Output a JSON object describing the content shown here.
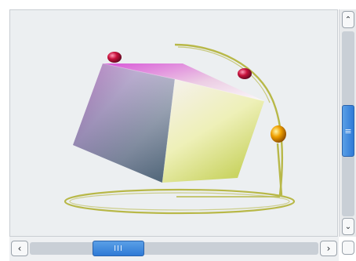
{
  "scroll_pane": {
    "vertical_scrollbar": {
      "up_arrow": "⌃",
      "down_arrow": "⌄",
      "thumb_grip": "≡",
      "thumb_position": 0.45
    },
    "horizontal_scrollbar": {
      "left_arrow": "‹",
      "right_arrow": "›",
      "thumb_grip": "III",
      "thumb_position": 0.29
    }
  },
  "scene": {
    "objects": [
      "rgb-color-cube",
      "orbit-ring",
      "orbit-arc",
      "orbit-rod",
      "sphere",
      "sphere",
      "sphere"
    ],
    "colors": {
      "ring": "#b8b848",
      "magenta_corner": "#e05ae0",
      "white_corner": "#f4f2f2",
      "yellow_corner": "#e6ee78",
      "dark_corner": "#2c4b60",
      "sphere_red": "#c0183c",
      "sphere_orange": "#f0a000"
    }
  }
}
